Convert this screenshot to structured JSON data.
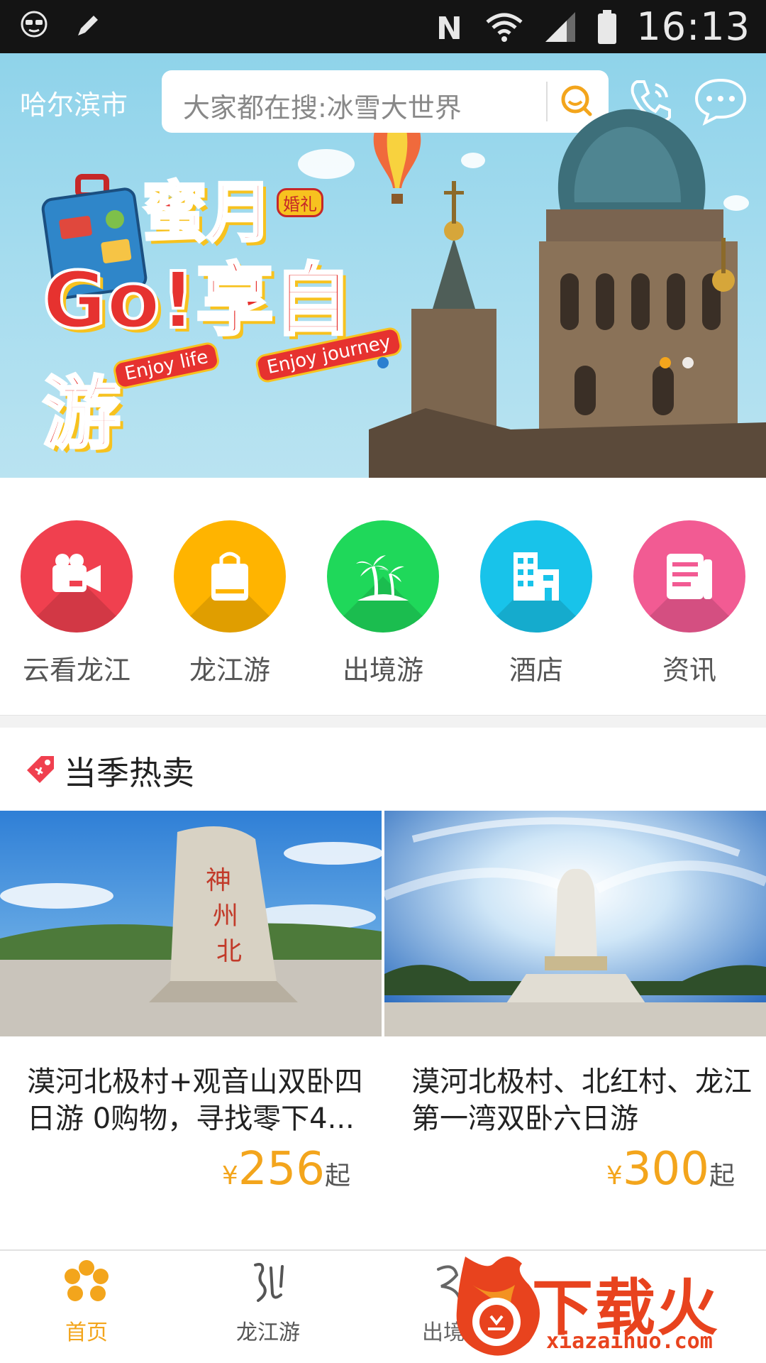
{
  "status_bar": {
    "time": "16:13"
  },
  "header": {
    "city": "哈尔滨市",
    "search_placeholder": "大家都在搜:冰雪大世界"
  },
  "banner": {
    "title_top": "蜜月",
    "title_main": "Go!享自游",
    "tagline_left": "Enjoy life",
    "tagline_right": "Enjoy journey",
    "badge": "婚礼",
    "slide_count": 3,
    "active_slide": 0
  },
  "categories": [
    {
      "label": "云看龙江",
      "icon": "video-camera-icon",
      "color": "#f0404f"
    },
    {
      "label": "龙江游",
      "icon": "shopping-bag-icon",
      "color": "#ffb400"
    },
    {
      "label": "出境游",
      "icon": "palm-tree-icon",
      "color": "#1fd85a"
    },
    {
      "label": "酒店",
      "icon": "building-icon",
      "color": "#18c3ea"
    },
    {
      "label": "资讯",
      "icon": "news-icon",
      "color": "#f25b93"
    }
  ],
  "section": {
    "title": "当季热卖"
  },
  "products": [
    {
      "name": "漠河北极村+观音山双卧四日游 0购物，寻找零下4...",
      "currency": "¥",
      "price": "256",
      "suffix": "起"
    },
    {
      "name": "漠河北极村、北红村、龙江第一湾双卧六日游",
      "currency": "¥",
      "price": "300",
      "suffix": "起"
    }
  ],
  "bottom_nav": [
    {
      "label": "首页",
      "active": true
    },
    {
      "label": "龙江游",
      "active": false
    },
    {
      "label": "出境游",
      "active": false
    }
  ],
  "watermark": {
    "text": "下载火",
    "url": "xiazaihuo.com"
  },
  "colors": {
    "accent": "#f3a51c",
    "banner_sky": "#a8ddef",
    "status_bar": "#141414"
  }
}
